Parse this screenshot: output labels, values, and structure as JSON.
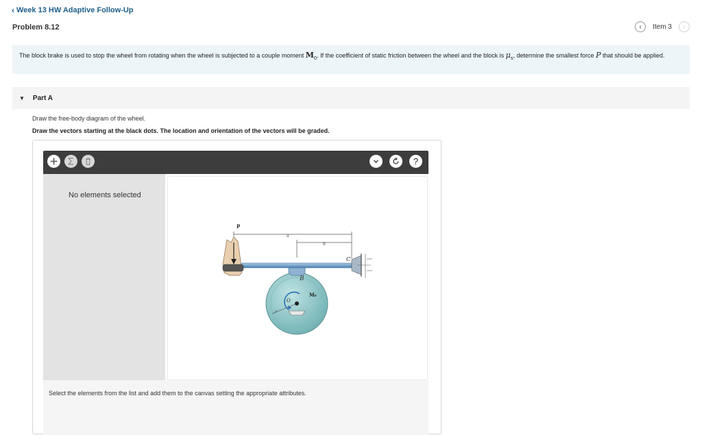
{
  "nav": {
    "back_label": "Week 13 HW Adaptive Follow-Up"
  },
  "problem": {
    "title": "Problem 8.12",
    "item_label": "Item 3"
  },
  "statement": {
    "part1": "The block brake is used to stop the wheel from rotating when the wheel is subjected to a couple moment ",
    "moment_symbol": "M",
    "moment_sub": "0",
    "part2": ". If the coefficient of static friction between the wheel and the block is ",
    "mu_symbol": "μ",
    "mu_sub": "s",
    "part3": ", determine the smallest force ",
    "force_symbol": "P",
    "part4": " that should be applied."
  },
  "part": {
    "label": "Part A"
  },
  "instructions": {
    "line1": "Draw the free-body diagram of the wheel.",
    "line2": "Draw the vectors starting at the black dots. The location and orientation of the vectors will be graded."
  },
  "tool": {
    "side_panel_text": "No elements selected",
    "bottom_text": "Select the elements from the list and add them to the canvas setting the appropriate attributes.",
    "help_label": "?"
  },
  "figure": {
    "label_P": "P",
    "label_a": "a",
    "label_b": "b",
    "label_C": "C",
    "label_B": "B",
    "label_O": "O",
    "label_M0": "M₀",
    "label_r": "r"
  },
  "icons": {
    "back": "chevron-left-icon",
    "prev": "chevron-left-circle-icon",
    "next": "chevron-right-circle-icon",
    "add": "plus-icon",
    "sum": "sigma-icon",
    "delete": "trash-icon",
    "dropdown": "chevron-down-icon",
    "reset": "reset-icon",
    "help": "help-icon"
  },
  "colors": {
    "link": "#1d5f8a",
    "statement_bg": "#eef5f8",
    "toolbar": "#3d3d3d",
    "wheel": "#8cc6c6",
    "lever": "#6e9fc6"
  }
}
